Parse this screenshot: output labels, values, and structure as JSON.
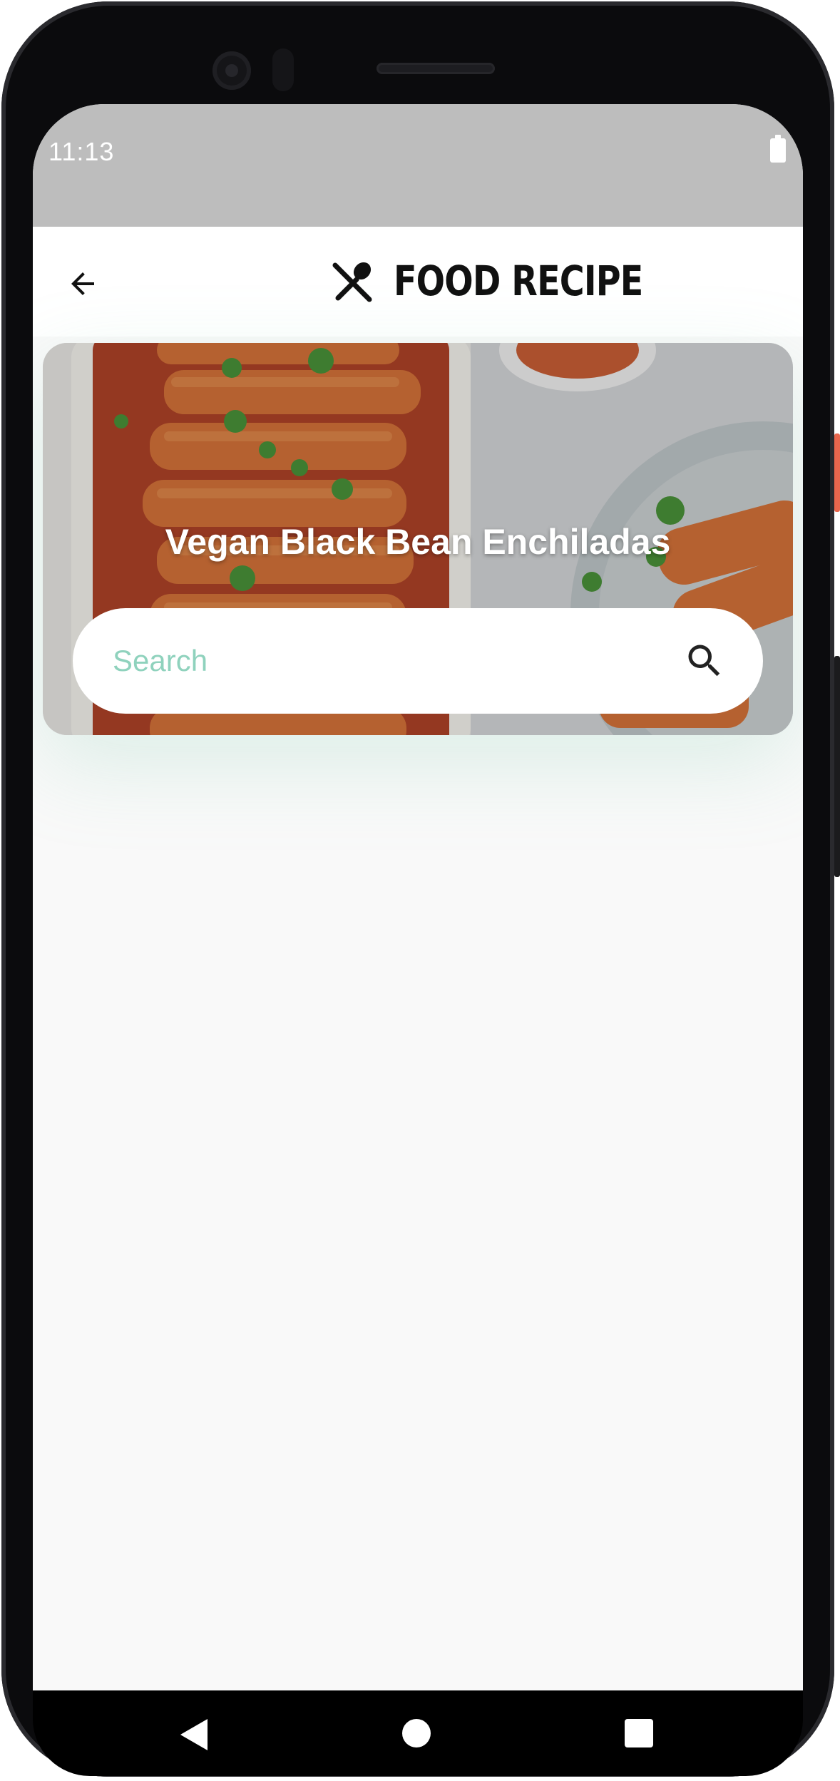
{
  "status_bar": {
    "time": "11:13"
  },
  "app_bar": {
    "title": "FOOD RECIPE"
  },
  "hero": {
    "recipe_title": "Vegan Black Bean Enchiladas"
  },
  "search": {
    "placeholder": "Search",
    "value": ""
  },
  "colors": {
    "accent": "#8fd2bd",
    "status_bar": "#bdbdbd",
    "enchilada_sauce": "#c4552a"
  }
}
